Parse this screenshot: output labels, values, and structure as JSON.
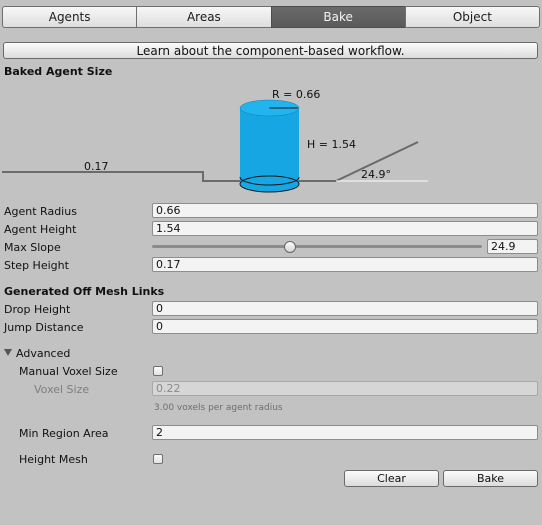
{
  "tabs": [
    "Agents",
    "Areas",
    "Bake",
    "Object"
  ],
  "active_tab": "Bake",
  "learn_button": "Learn about the component-based workflow.",
  "baked_agent_size": {
    "header": "Baked Agent Size",
    "diagram": {
      "radius_label": "R = 0.66",
      "height_label": "H = 1.54",
      "step_label": "0.17",
      "slope_label": "24.9°",
      "cylinder_color": "#16a6e4"
    }
  },
  "agent_fields": [
    {
      "label": "Agent Radius",
      "value": "0.66"
    },
    {
      "label": "Agent Height",
      "value": "1.54"
    },
    {
      "label": "Max Slope",
      "value": "24.9",
      "slider_fraction": 0.415
    },
    {
      "label": "Step Height",
      "value": "0.17"
    }
  ],
  "off_mesh": {
    "header": "Generated Off Mesh Links",
    "fields": [
      {
        "label": "Drop Height",
        "value": "0"
      },
      {
        "label": "Jump Distance",
        "value": "0"
      }
    ]
  },
  "advanced": {
    "label": "Advanced",
    "manual_voxel_size": "Manual Voxel Size",
    "voxel_size_label": "Voxel Size",
    "voxel_size_value": "0.22",
    "voxel_note": "3.00 voxels per agent radius",
    "min_region_area_label": "Min Region Area",
    "min_region_area_value": "2",
    "height_mesh_label": "Height Mesh"
  },
  "buttons": {
    "clear": "Clear",
    "bake": "Bake"
  }
}
